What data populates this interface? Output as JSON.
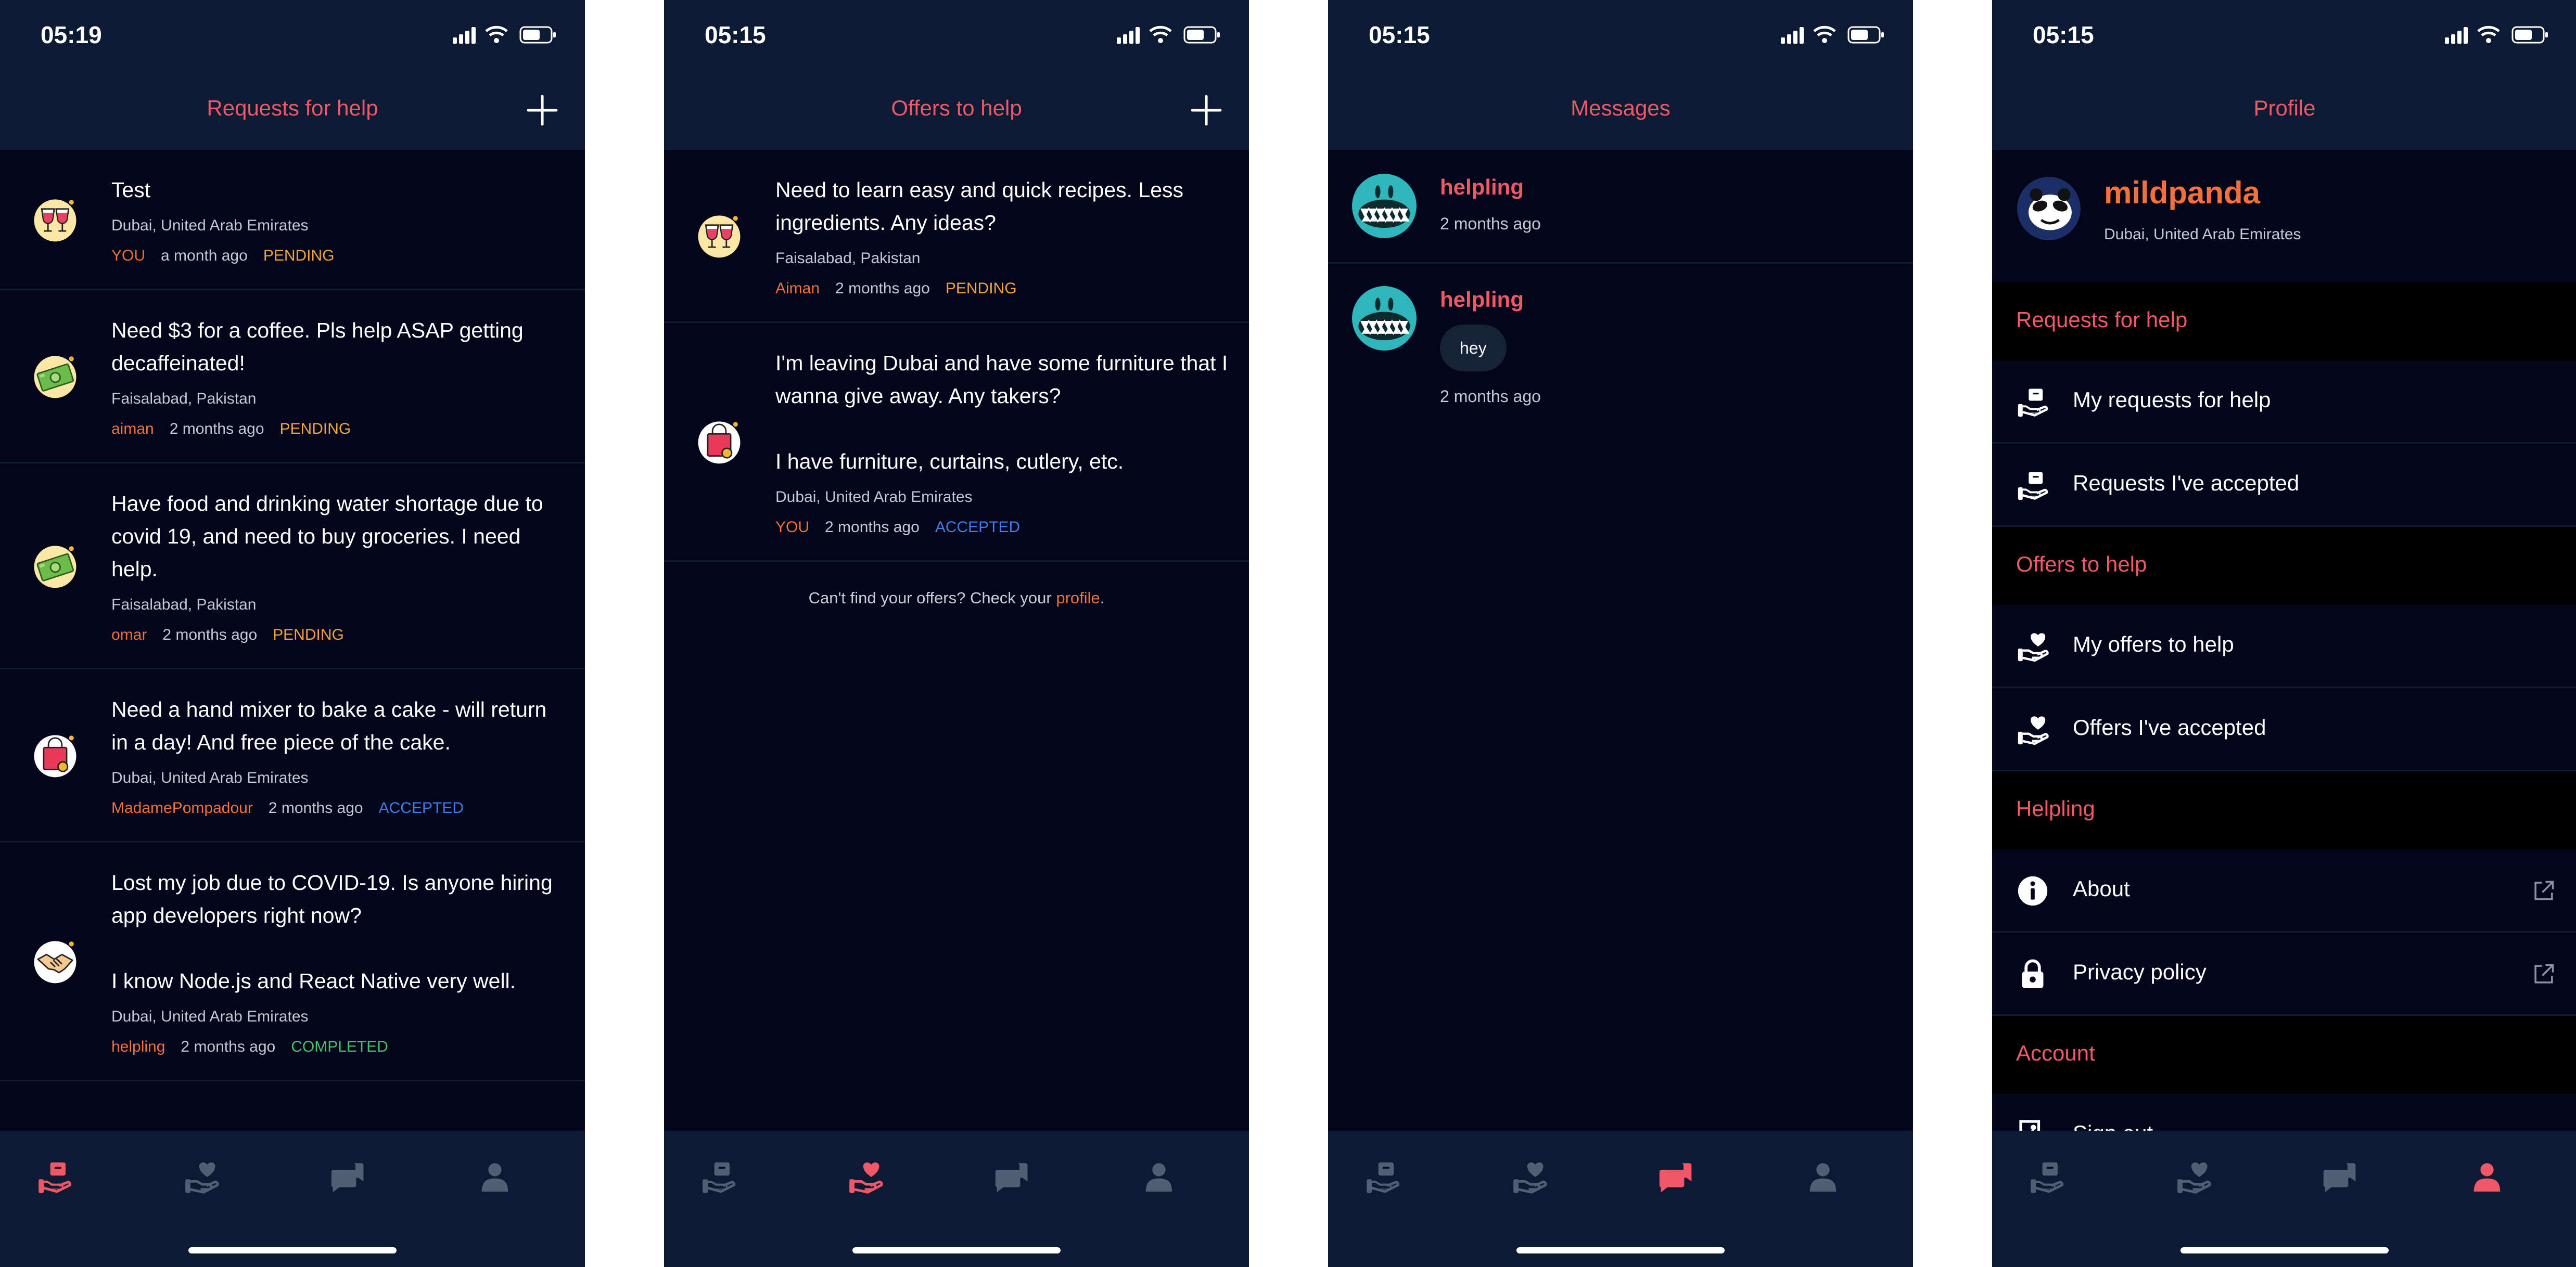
{
  "colors": {
    "accent": "#f05868",
    "username": "#f4703a",
    "pending": "#f3a33c",
    "accepted": "#3d7eea",
    "completed": "#46c36a",
    "bar_bg": "#0c1a33",
    "screen_bg": "#03061a",
    "inactive_tab": "#525e74"
  },
  "screens": [
    {
      "time": "05:19",
      "title": "Requests for help",
      "has_add": true,
      "active_tab": 0,
      "items": [
        {
          "title": "Test",
          "location": "Dubai, United Arab Emirates",
          "user": "YOU",
          "age": "a month ago",
          "status": "PENDING",
          "icon": "wine-glass-icon"
        },
        {
          "title": "Need $3 for a coffee. Pls help ASAP getting decaffeinated!",
          "location": "Faisalabad, Pakistan",
          "user": "aiman",
          "age": "2 months ago",
          "status": "PENDING",
          "icon": "money-icon"
        },
        {
          "title": "Have food and drinking water shortage due to covid 19, and need to buy groceries. I need help.",
          "location": "Faisalabad, Pakistan",
          "user": "omar",
          "age": "2 months ago",
          "status": "PENDING",
          "icon": "money-icon"
        },
        {
          "title": "Need a hand mixer to bake a cake - will return in a day! And free piece of the cake.",
          "location": "Dubai, United Arab Emirates",
          "user": "MadamePompadour",
          "age": "2 months ago",
          "status": "ACCEPTED",
          "icon": "shopping-bag-icon"
        },
        {
          "title": "Lost my job due to COVID-19. Is anyone hiring app developers right now?\n\nI know Node.js and React Native very well.",
          "location": "Dubai, United Arab Emirates",
          "user": "helpling",
          "age": "2 months ago",
          "status": "COMPLETED",
          "icon": "handshake-icon"
        }
      ]
    },
    {
      "time": "05:15",
      "title": "Offers to help",
      "has_add": true,
      "active_tab": 1,
      "items": [
        {
          "title": "Need to learn easy and quick recipes. Less ingredients. Any ideas?",
          "location": "Faisalabad, Pakistan",
          "user": "Aiman",
          "age": "2 months ago",
          "status": "PENDING",
          "icon": "wine-glass-icon"
        },
        {
          "title": "I'm leaving Dubai and have some furniture that I wanna give away. Any takers?\n\nI have furniture, curtains, cutlery, etc.",
          "location": "Dubai, United Arab Emirates",
          "user": "YOU",
          "age": "2 months ago",
          "status": "ACCEPTED",
          "icon": "shopping-bag-icon"
        }
      ],
      "footer_note": "Can't find your offers? Check your ",
      "footer_link": "profile",
      "footer_end": "."
    },
    {
      "time": "05:15",
      "title": "Messages",
      "has_add": false,
      "active_tab": 2,
      "conversations": [
        {
          "name": "helpling",
          "time": "2 months ago"
        },
        {
          "name": "helpling",
          "bubble": "hey",
          "time": "2 months ago"
        }
      ]
    },
    {
      "time": "05:15",
      "title": "Profile",
      "has_add": false,
      "active_tab": 3,
      "user": {
        "name": "mildpanda",
        "location": "Dubai, United Arab Emirates"
      },
      "sections": [
        {
          "label": "Requests for help",
          "rows": [
            {
              "label": "My requests for help",
              "icon": "hand-box-icon",
              "external": false
            },
            {
              "label": "Requests I've accepted",
              "icon": "hand-box-icon",
              "external": false
            }
          ]
        },
        {
          "label": "Offers to help",
          "rows": [
            {
              "label": "My offers to help",
              "icon": "hand-heart-icon",
              "external": false
            },
            {
              "label": "Offers I've accepted",
              "icon": "hand-heart-icon",
              "external": false
            }
          ]
        },
        {
          "label": "Helpling",
          "rows": [
            {
              "label": "About",
              "icon": "info-icon",
              "external": true
            },
            {
              "label": "Privacy policy",
              "icon": "lock-icon",
              "external": true
            }
          ]
        },
        {
          "label": "Account",
          "rows": [
            {
              "label": "Sign out",
              "icon": "sign-out-icon",
              "external": false
            }
          ]
        }
      ]
    }
  ],
  "tabs": [
    {
      "name": "requests",
      "icon": "hand-box-icon"
    },
    {
      "name": "offers",
      "icon": "hand-heart-icon"
    },
    {
      "name": "messages",
      "icon": "chat-bubbles-icon"
    },
    {
      "name": "profile",
      "icon": "person-icon"
    }
  ]
}
